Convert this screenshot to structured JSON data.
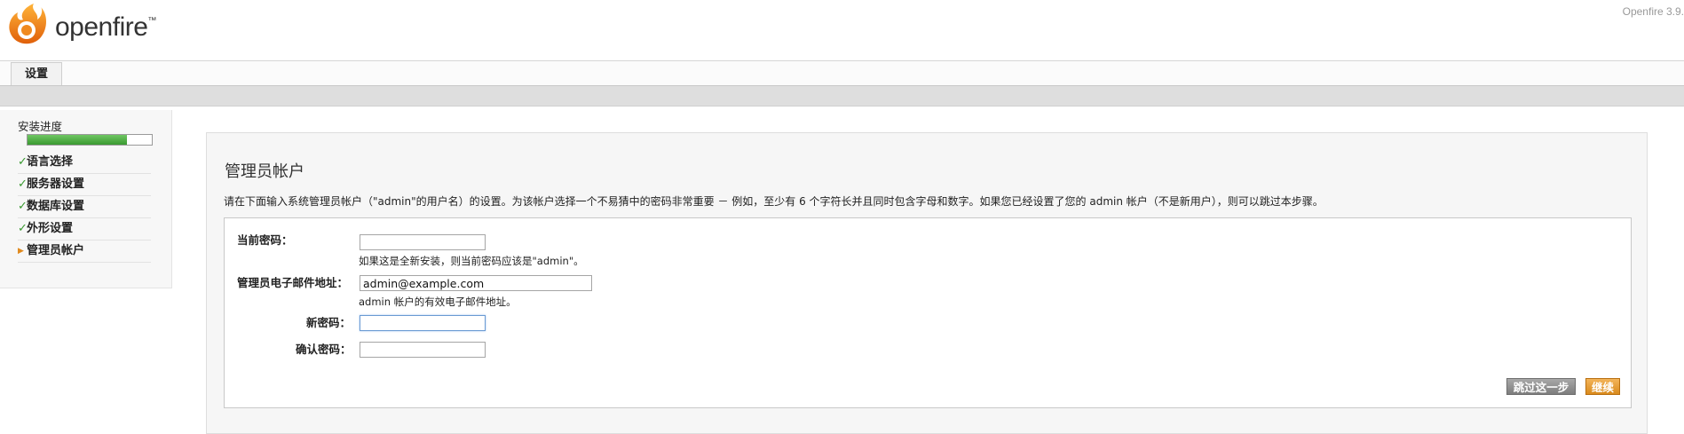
{
  "header": {
    "logo_text": "openfire",
    "logo_tm": "™",
    "version": "Openfire 3.9."
  },
  "tabs": [
    {
      "label": "设置"
    }
  ],
  "sidebar": {
    "progress_label": "安装进度",
    "progress_fraction": 0.8,
    "steps": [
      {
        "label": "语言选择",
        "status": "done"
      },
      {
        "label": "服务器设置",
        "status": "done"
      },
      {
        "label": "数据库设置",
        "status": "done"
      },
      {
        "label": "外形设置",
        "status": "done"
      },
      {
        "label": "管理员帐户",
        "status": "current"
      }
    ]
  },
  "main": {
    "title": "管理员帐户",
    "description": "请在下面输入系统管理员帐户（\"admin\"的用户名）的设置。为该帐户选择一个不易猜中的密码非常重要 － 例如，至少有 6 个字符长并且同时包含字母和数字。如果您已经设置了您的 admin 帐户（不是新用户），则可以跳过本步骤。",
    "form": {
      "current_password_label": "当前密码：",
      "current_password_value": "",
      "current_password_hint": "如果这是全新安装，则当前密码应该是\"admin\"。",
      "email_label": "管理员电子邮件地址：",
      "email_value": "admin@example.com",
      "email_hint": "admin 帐户的有效电子邮件地址。",
      "new_password_label": "新密码：",
      "new_password_value": "",
      "confirm_password_label": "确认密码：",
      "confirm_password_value": ""
    },
    "buttons": {
      "skip_label": "跳过这一步",
      "continue_label": "继续"
    }
  },
  "colors": {
    "progress_fill": "#3a9a31",
    "check": "#3a9a31",
    "current_arrow": "#e08a1e",
    "continue_button": "#d98a1c",
    "skip_button": "#7d7d7d"
  }
}
